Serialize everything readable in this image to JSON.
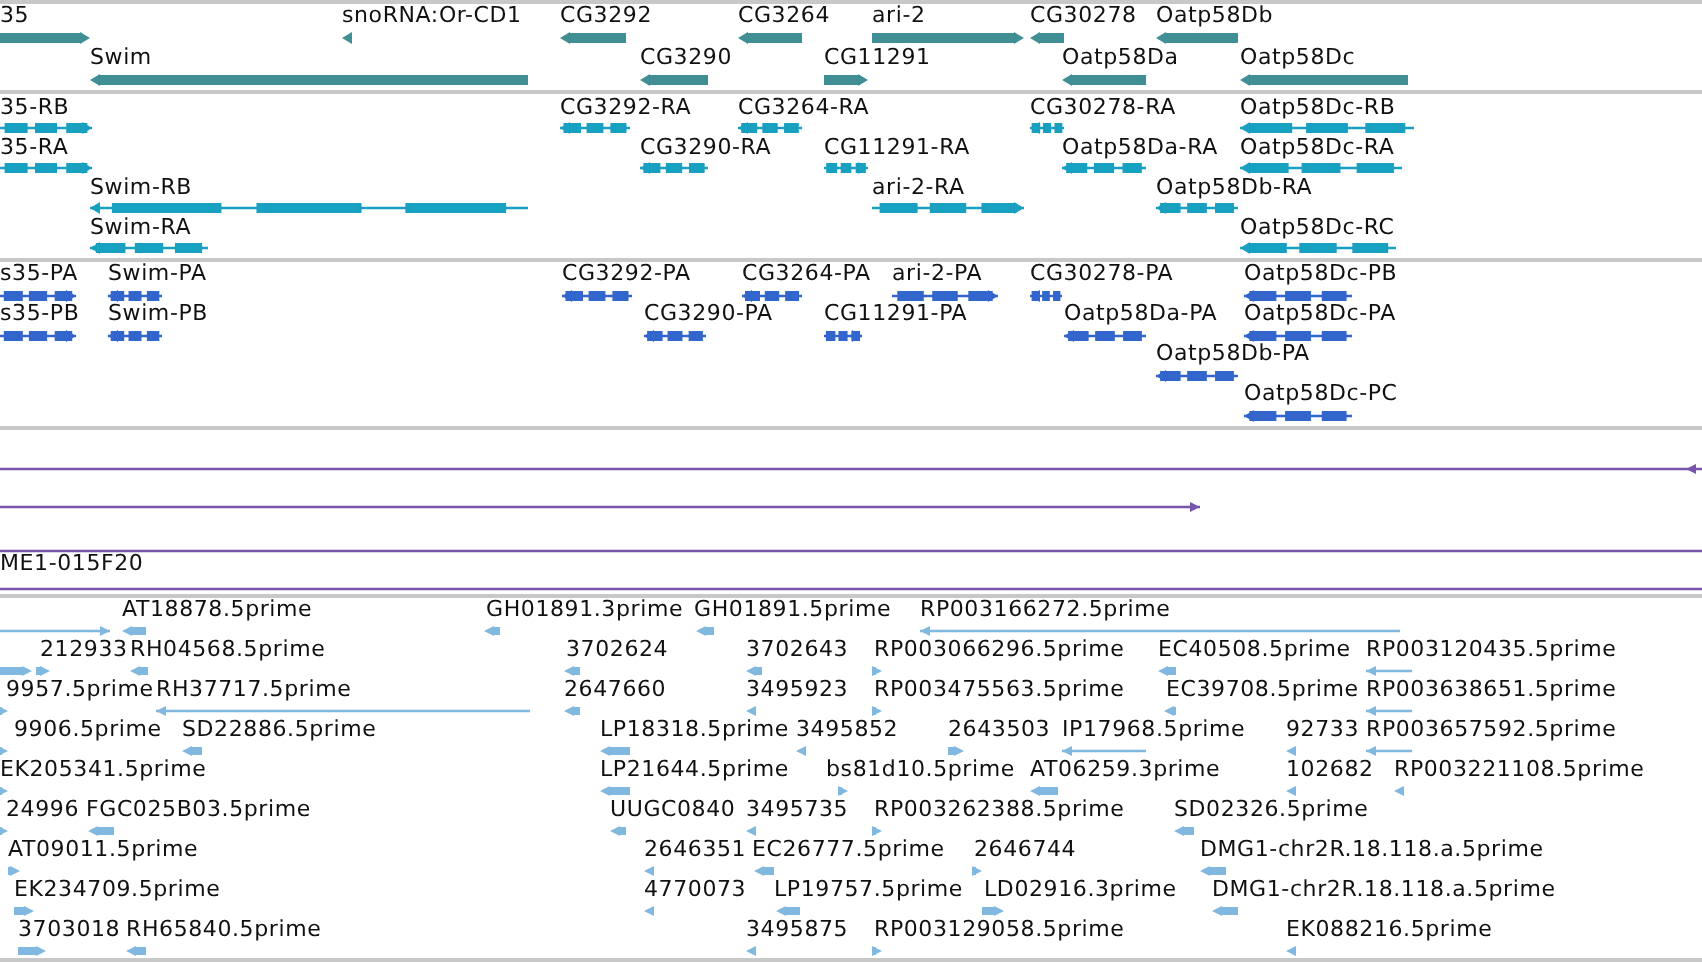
{
  "tracks": [
    {
      "kind": "genes",
      "color": "#3f8f94",
      "features": [
        {
          "label": "35",
          "reverse": false
        },
        {
          "label": "snoRNA:Or-CD1",
          "reverse": true
        },
        {
          "label": "CG3292",
          "reverse": true
        },
        {
          "label": "CG3264",
          "reverse": true
        },
        {
          "label": "ari-2",
          "reverse": false
        },
        {
          "label": "CG30278",
          "reverse": true
        },
        {
          "label": "Oatp58Db",
          "reverse": true
        },
        {
          "label": "Swim",
          "reverse": true
        },
        {
          "label": "CG3290",
          "reverse": true
        },
        {
          "label": "CG11291",
          "reverse": false
        },
        {
          "label": "Oatp58Da",
          "reverse": true
        },
        {
          "label": "Oatp58Dc",
          "reverse": true
        }
      ]
    },
    {
      "kind": "transcripts",
      "color": "#17a0c0",
      "features": [
        {
          "label": "35-RB",
          "reverse": false
        },
        {
          "label": "CG3292-RA",
          "reverse": true
        },
        {
          "label": "CG3264-RA",
          "reverse": true
        },
        {
          "label": "CG30278-RA",
          "reverse": true
        },
        {
          "label": "Oatp58Dc-RB",
          "reverse": true
        },
        {
          "label": "35-RA",
          "reverse": false
        },
        {
          "label": "CG3290-RA",
          "reverse": true
        },
        {
          "label": "CG11291-RA",
          "reverse": false
        },
        {
          "label": "Oatp58Da-RA",
          "reverse": true
        },
        {
          "label": "Oatp58Dc-RA",
          "reverse": true
        },
        {
          "label": "Swim-RB",
          "reverse": true
        },
        {
          "label": "ari-2-RA",
          "reverse": false
        },
        {
          "label": "Oatp58Db-RA",
          "reverse": true
        },
        {
          "label": "Swim-RA",
          "reverse": true
        },
        {
          "label": "Oatp58Dc-RC",
          "reverse": true
        }
      ]
    },
    {
      "kind": "proteins",
      "color": "#3366cc",
      "features": [
        {
          "label": "s35-PA",
          "reverse": false
        },
        {
          "label": "Swim-PA",
          "reverse": true
        },
        {
          "label": "CG3292-PA",
          "reverse": true
        },
        {
          "label": "CG3264-PA",
          "reverse": true
        },
        {
          "label": "ari-2-PA",
          "reverse": false
        },
        {
          "label": "CG30278-PA",
          "reverse": true
        },
        {
          "label": "Oatp58Dc-PB",
          "reverse": true
        },
        {
          "label": "s35-PB",
          "reverse": false
        },
        {
          "label": "Swim-PB",
          "reverse": true
        },
        {
          "label": "CG3290-PA",
          "reverse": true
        },
        {
          "label": "CG11291-PA",
          "reverse": false
        },
        {
          "label": "Oatp58Da-PA",
          "reverse": true
        },
        {
          "label": "Oatp58Dc-PA",
          "reverse": true
        },
        {
          "label": "Oatp58Db-PA",
          "reverse": true
        },
        {
          "label": "Oatp58Dc-PC",
          "reverse": true
        }
      ]
    },
    {
      "kind": "alignments",
      "color": "#7755aa",
      "features": [
        {
          "kind": "capped"
        },
        {
          "kind": "line",
          "reverse": false
        },
        {
          "kind": "line"
        },
        {
          "kind": "line",
          "label": "ME1-015F20"
        }
      ]
    },
    {
      "kind": "ests",
      "color": "#80b8e0",
      "features": [
        {
          "reverse": false
        },
        {
          "label": "AT18878.5prime",
          "reverse": true
        },
        {
          "label": "GH01891.3prime",
          "reverse": true
        },
        {
          "label": "GH01891.5prime",
          "reverse": true
        },
        {
          "label": "RP003166272.5prime",
          "reverse": true
        },
        {
          "reverse": false
        },
        {
          "label": "212933",
          "reverse": false
        },
        {
          "label": "RH04568.5prime",
          "reverse": true
        },
        {
          "label": "3702624",
          "reverse": true
        },
        {
          "label": "3702643",
          "reverse": true
        },
        {
          "label": "RP003066296.5prime",
          "reverse": false
        },
        {
          "label": "EC40508.5prime",
          "reverse": true
        },
        {
          "label": "RP003120435.5prime",
          "reverse": true
        },
        {
          "label": "9957.5prime",
          "reverse": false
        },
        {
          "label": "RH37717.5prime",
          "reverse": true
        },
        {
          "label": "2647660",
          "reverse": true
        },
        {
          "label": "3495923",
          "reverse": true
        },
        {
          "label": "RP003475563.5prime",
          "reverse": false
        },
        {
          "label": "EC39708.5prime",
          "reverse": true
        },
        {
          "label": "RP003638651.5prime",
          "reverse": true
        },
        {
          "label": "9906.5prime",
          "reverse": false
        },
        {
          "label": "SD22886.5prime",
          "reverse": true
        },
        {
          "label": "LP18318.5prime",
          "reverse": true
        },
        {
          "label": "3495852",
          "reverse": true
        },
        {
          "label": "2643503",
          "reverse": false
        },
        {
          "label": "IP17968.5prime",
          "reverse": true
        },
        {
          "label": "92733",
          "reverse": true
        },
        {
          "label": "RP003657592.5prime",
          "reverse": true
        },
        {
          "label": "EK205341.5prime",
          "reverse": false
        },
        {
          "label": "LP21644.5prime",
          "reverse": true
        },
        {
          "label": "bs81d10.5prime",
          "reverse": false
        },
        {
          "label": "AT06259.3prime",
          "reverse": true
        },
        {
          "label": "102682",
          "reverse": true
        },
        {
          "label": "RP003221108.5prime",
          "reverse": true
        },
        {
          "label": "24996",
          "reverse": false
        },
        {
          "label": "FGC025B03.5prime",
          "reverse": true
        },
        {
          "label": "UUGC0840",
          "reverse": true
        },
        {
          "label": "3495735",
          "reverse": true
        },
        {
          "label": "RP003262388.5prime",
          "reverse": false
        },
        {
          "label": "SD02326.5prime",
          "reverse": true
        },
        {
          "label": "AT09011.5prime",
          "reverse": false
        },
        {
          "label": "2646351",
          "reverse": true
        },
        {
          "label": "EC26777.5prime",
          "reverse": true
        },
        {
          "label": "2646744",
          "reverse": false
        },
        {
          "label": "DMG1-chr2R.18.118.a.5prime",
          "reverse": true
        },
        {
          "label": "EK234709.5prime",
          "reverse": false
        },
        {
          "label": "4770073",
          "reverse": true
        },
        {
          "label": "LP19757.5prime",
          "reverse": true
        },
        {
          "label": "LD02916.3prime",
          "reverse": false
        },
        {
          "label": "DMG1-chr2R.18.118.a.5prime",
          "reverse": true
        },
        {
          "label": "3703018",
          "reverse": false
        },
        {
          "label": "RH65840.5prime",
          "reverse": true
        },
        {
          "label": "3495875",
          "reverse": true
        },
        {
          "label": "RP003129058.5prime",
          "reverse": false
        },
        {
          "label": "EK088216.5prime",
          "reverse": true
        }
      ]
    }
  ]
}
